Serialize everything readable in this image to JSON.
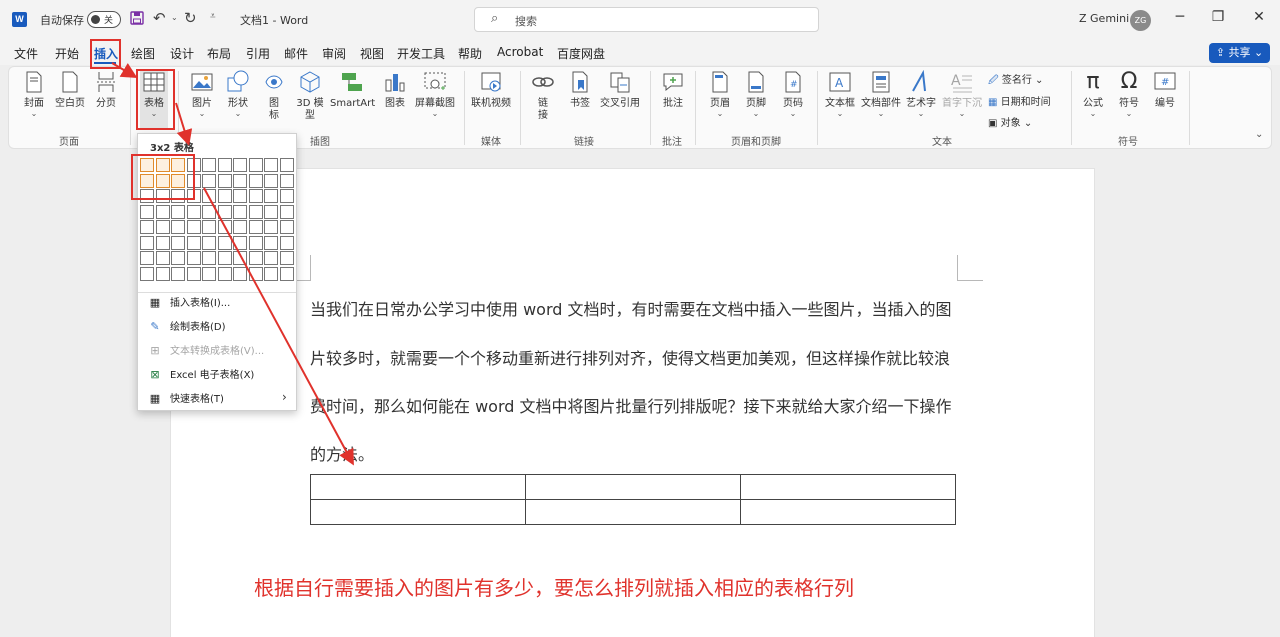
{
  "titlebar": {
    "autosave_label": "自动保存",
    "autosave_state": "关",
    "doc_title": "文档1  -  Word",
    "search_placeholder": "搜索",
    "user_name": "Z Gemini",
    "user_initials": "ZG",
    "icons": [
      "save-icon",
      "undo-icon",
      "redo-icon",
      "customize-icon"
    ]
  },
  "menu": {
    "items": [
      "文件",
      "开始",
      "插入",
      "绘图",
      "设计",
      "布局",
      "引用",
      "邮件",
      "审阅",
      "视图",
      "开发工具",
      "帮助",
      "Acrobat",
      "百度网盘"
    ],
    "active": "插入",
    "share": "共享"
  },
  "ribbon": {
    "buttons": {
      "cover": "封面",
      "blank": "空白页",
      "pagebreak": "分页",
      "table": "表格",
      "picture": "图片",
      "shapes": "形状",
      "icons": "图\n标",
      "models": "3D 模\n型",
      "smartart": "SmartArt",
      "chart": "图表",
      "screenshot": "屏幕截图",
      "video": "联机视频",
      "link": "链\n接",
      "bookmark": "书签",
      "crossref": "交叉引用",
      "comment": "批注",
      "header": "页眉",
      "footer": "页脚",
      "pagenum": "页码",
      "textbox": "文本框",
      "quickparts": "文档部件",
      "wordart": "艺术字",
      "dropcap": "首字下沉",
      "signature": "签名行",
      "datetime": "日期和时间",
      "object": "对象",
      "equation": "公式",
      "symbol": "符号",
      "number": "编号"
    },
    "groups": {
      "pages": "页面",
      "illustrations": "插图",
      "media": "媒体",
      "links": "链接",
      "comments": "批注",
      "headerfooter": "页眉和页脚",
      "text": "文本",
      "symbols": "符号"
    }
  },
  "table_dropdown": {
    "title": "3x2 表格",
    "grid_cols": 10,
    "grid_rows": 8,
    "selected_cols": 3,
    "selected_rows": 2,
    "items": [
      {
        "label": "插入表格(I)...",
        "icon": "insert-table-icon",
        "enabled": true
      },
      {
        "label": "绘制表格(D)",
        "icon": "draw-table-icon",
        "enabled": true
      },
      {
        "label": "文本转换成表格(V)...",
        "icon": "convert-text-icon",
        "enabled": false
      },
      {
        "label": "Excel 电子表格(X)",
        "icon": "excel-icon",
        "enabled": true
      },
      {
        "label": "快速表格(T)",
        "icon": "quick-table-icon",
        "enabled": true
      }
    ]
  },
  "document": {
    "paragraph_lines": [
      "当我们在日常办公学习中使用 word 文档时，有时需要在文档中插入一些图片，当插入的图",
      "片较多时，就需要一个个移动重新进行排列对齐，使得文档更加美观，但这样操作就比较浪",
      "费时间，那么如何能在 word 文档中将图片批量行列排版呢？接下来就给大家介绍一下操作",
      "的方法。"
    ],
    "table_rows": 2,
    "table_cols": 3
  },
  "annotation": {
    "note": "根据自行需要插入的图片有多少，要怎么排列就插入相应的表格行列",
    "color": "#e0322c"
  },
  "colors": {
    "accent": "#185abd",
    "highlight": "#e08b2c"
  }
}
